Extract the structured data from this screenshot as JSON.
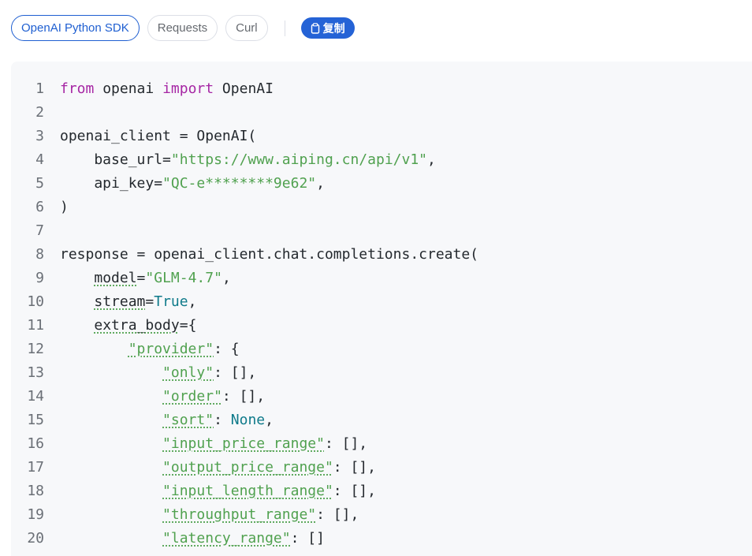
{
  "tabs": [
    {
      "label": "OpenAI Python SDK",
      "active": true
    },
    {
      "label": "Requests",
      "active": false
    },
    {
      "label": "Curl",
      "active": false
    }
  ],
  "copy_label": "复制",
  "colors": {
    "accent": "#2563d6",
    "keyword": "#a626a4",
    "string": "#50a14f",
    "constant": "#0e7a8a"
  },
  "code_lines": [
    {
      "n": "1",
      "tokens": [
        {
          "t": "from",
          "c": "k"
        },
        {
          "t": " openai "
        },
        {
          "t": "import",
          "c": "k"
        },
        {
          "t": " OpenAI"
        }
      ]
    },
    {
      "n": "2",
      "tokens": []
    },
    {
      "n": "3",
      "tokens": [
        {
          "t": "openai_client = OpenAI("
        }
      ]
    },
    {
      "n": "4",
      "tokens": [
        {
          "t": "    base_url="
        },
        {
          "t": "\"https://www.aiping.cn/api/v1\"",
          "c": "s"
        },
        {
          "t": ","
        }
      ]
    },
    {
      "n": "5",
      "tokens": [
        {
          "t": "    api_key="
        },
        {
          "t": "\"QC-e********9e62\"",
          "c": "s"
        },
        {
          "t": ","
        }
      ]
    },
    {
      "n": "6",
      "tokens": [
        {
          "t": ")"
        }
      ]
    },
    {
      "n": "7",
      "tokens": []
    },
    {
      "n": "8",
      "tokens": [
        {
          "t": "response = openai_client.chat.completions.create("
        }
      ]
    },
    {
      "n": "9",
      "tokens": [
        {
          "t": "    "
        },
        {
          "t": "model",
          "c": "u"
        },
        {
          "t": "="
        },
        {
          "t": "\"GLM-4.7\"",
          "c": "s"
        },
        {
          "t": ","
        }
      ]
    },
    {
      "n": "10",
      "tokens": [
        {
          "t": "    "
        },
        {
          "t": "stream",
          "c": "u"
        },
        {
          "t": "="
        },
        {
          "t": "True",
          "c": "c"
        },
        {
          "t": ","
        }
      ]
    },
    {
      "n": "11",
      "tokens": [
        {
          "t": "    "
        },
        {
          "t": "extra_body",
          "c": "u"
        },
        {
          "t": "={"
        }
      ]
    },
    {
      "n": "12",
      "tokens": [
        {
          "t": "        "
        },
        {
          "t": "\"provider\"",
          "c": "s u"
        },
        {
          "t": ": {"
        }
      ]
    },
    {
      "n": "13",
      "tokens": [
        {
          "t": "            "
        },
        {
          "t": "\"only\"",
          "c": "s u"
        },
        {
          "t": ": [],"
        }
      ]
    },
    {
      "n": "14",
      "tokens": [
        {
          "t": "            "
        },
        {
          "t": "\"order\"",
          "c": "s u"
        },
        {
          "t": ": [],"
        }
      ]
    },
    {
      "n": "15",
      "tokens": [
        {
          "t": "            "
        },
        {
          "t": "\"sort\"",
          "c": "s u"
        },
        {
          "t": ": "
        },
        {
          "t": "None",
          "c": "c"
        },
        {
          "t": ","
        }
      ]
    },
    {
      "n": "16",
      "tokens": [
        {
          "t": "            "
        },
        {
          "t": "\"input_price_range\"",
          "c": "s u"
        },
        {
          "t": ": [],"
        }
      ]
    },
    {
      "n": "17",
      "tokens": [
        {
          "t": "            "
        },
        {
          "t": "\"output_price_range\"",
          "c": "s u"
        },
        {
          "t": ": [],"
        }
      ]
    },
    {
      "n": "18",
      "tokens": [
        {
          "t": "            "
        },
        {
          "t": "\"input_length_range\"",
          "c": "s u"
        },
        {
          "t": ": [],"
        }
      ]
    },
    {
      "n": "19",
      "tokens": [
        {
          "t": "            "
        },
        {
          "t": "\"throughput_range\"",
          "c": "s u"
        },
        {
          "t": ": [],"
        }
      ]
    },
    {
      "n": "20",
      "tokens": [
        {
          "t": "            "
        },
        {
          "t": "\"latency_range\"",
          "c": "s u"
        },
        {
          "t": ": []"
        }
      ]
    }
  ]
}
